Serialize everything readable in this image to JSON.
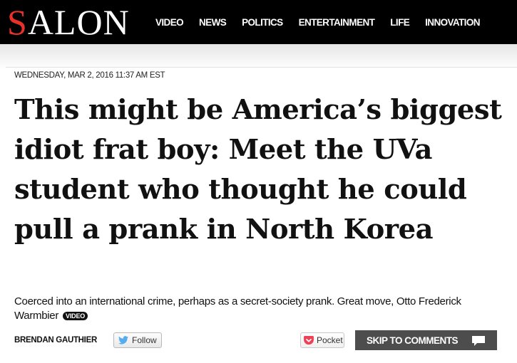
{
  "header": {
    "logo_first": "S",
    "logo_rest": "ALON",
    "nav": [
      "VIDEO",
      "NEWS",
      "POLITICS",
      "ENTERTAINMENT",
      "LIFE",
      "INNOVATION"
    ]
  },
  "article": {
    "dateline": "WEDNESDAY, MAR 2, 2016 11:37 AM EST",
    "headline": "This might be America’s biggest idiot frat boy: Meet the UVa student who thought he could pull a prank in North Korea",
    "dek": "Coerced into an international crime, perhaps as a secret-society prank. Great move, Otto Frederick Warmbier",
    "video_badge": "VIDEO"
  },
  "byline": {
    "author": "BRENDAN GAUTHIER",
    "follow_label": "Follow",
    "pocket_label": "Pocket",
    "skip_label": "SKIP TO COMMENTS"
  },
  "colors": {
    "brand_red": "#e8312a",
    "topbar": "#000000",
    "skip_button": "#4d4d4d",
    "twitter_blue": "#55acee",
    "pocket_red": "#ee4056"
  },
  "icons": [
    "twitter-bird-icon",
    "pocket-icon",
    "comment-bubble-icon"
  ]
}
